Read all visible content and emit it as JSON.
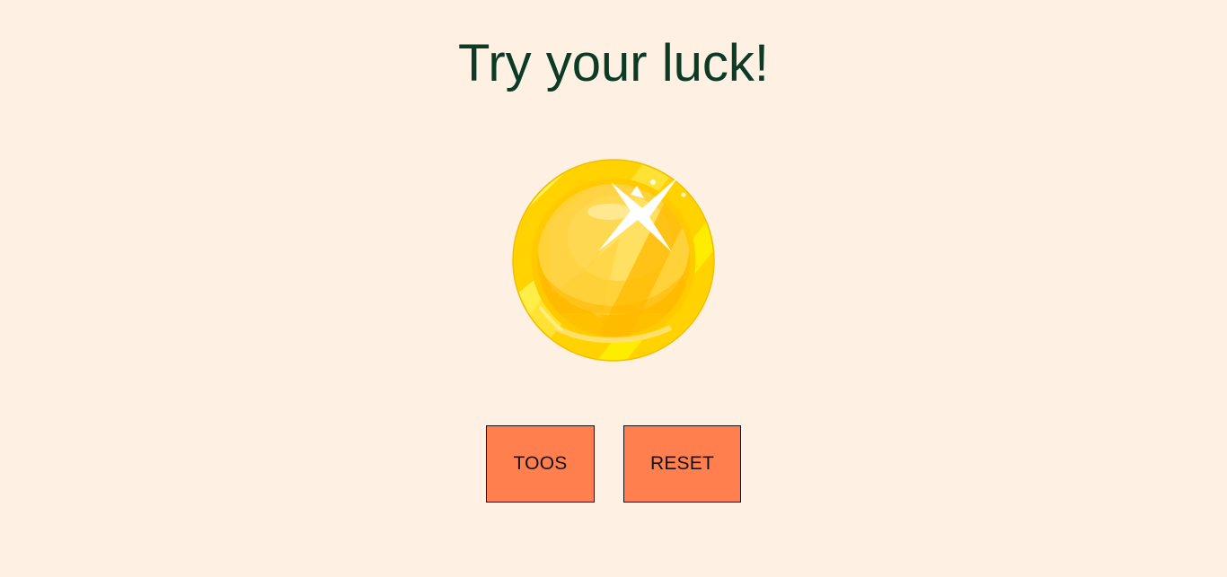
{
  "header": {
    "title": "Try your luck!"
  },
  "coin": {
    "icon": "gold-coin-icon",
    "colors": {
      "outer_rim": "#ffe600",
      "inner_face": "#ffc400",
      "shine": "#ffffff"
    }
  },
  "controls": {
    "toss_label": "TOOS",
    "reset_label": "RESET"
  },
  "theme": {
    "background": "#fef1e4",
    "title_color": "#0b3b24",
    "button_color": "#ff7f4f"
  }
}
